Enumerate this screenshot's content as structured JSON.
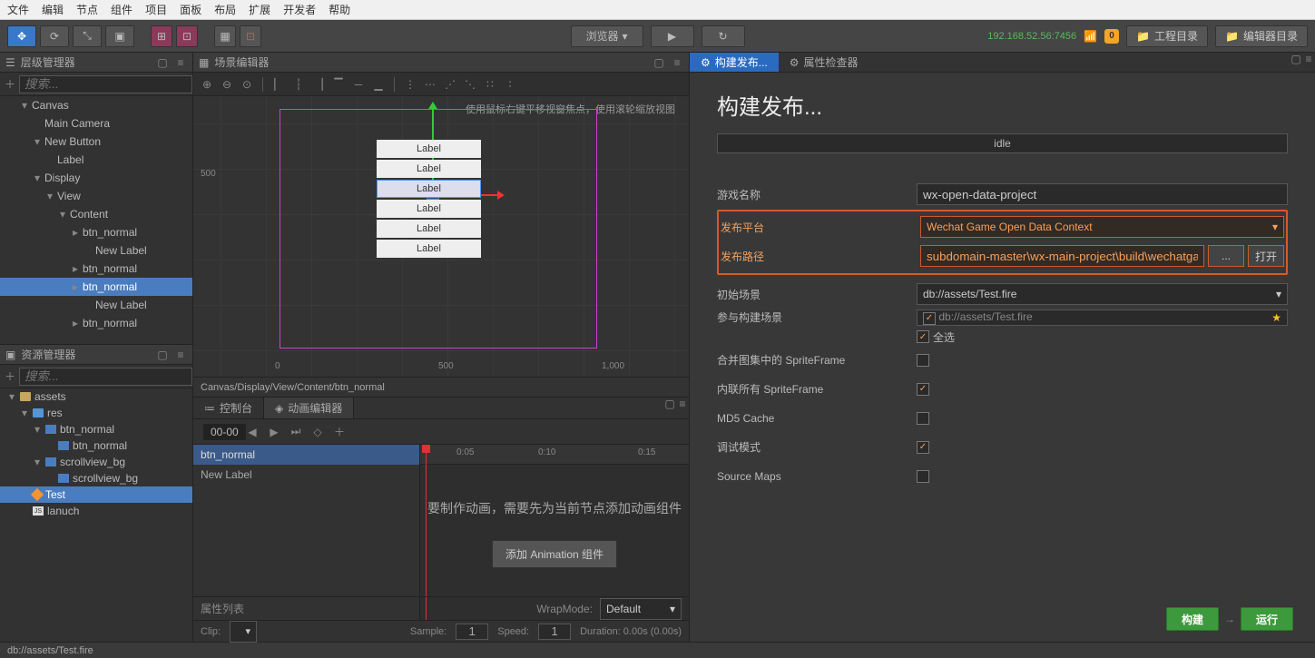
{
  "menubar": [
    "文件",
    "编辑",
    "节点",
    "组件",
    "项目",
    "面板",
    "布局",
    "扩展",
    "开发者",
    "帮助"
  ],
  "toolbar": {
    "preview_mode": "浏览器",
    "ip": "192.168.52.56:7456",
    "badge": "0",
    "project_dir": "工程目录",
    "editor_dir": "编辑器目录"
  },
  "hierarchy": {
    "title": "层级管理器",
    "search_placeholder": "搜索...",
    "tree": [
      {
        "indent": 1,
        "caret": "▾",
        "label": "Canvas"
      },
      {
        "indent": 2,
        "caret": "",
        "label": "Main Camera"
      },
      {
        "indent": 2,
        "caret": "▾",
        "label": "New Button"
      },
      {
        "indent": 3,
        "caret": "",
        "label": "Label"
      },
      {
        "indent": 2,
        "caret": "▾",
        "label": "Display"
      },
      {
        "indent": 3,
        "caret": "▾",
        "label": "View"
      },
      {
        "indent": 4,
        "caret": "▾",
        "label": "Content"
      },
      {
        "indent": 5,
        "caret": "▸",
        "label": "btn_normal"
      },
      {
        "indent": 6,
        "caret": "",
        "label": "New Label"
      },
      {
        "indent": 5,
        "caret": "▸",
        "label": "btn_normal"
      },
      {
        "indent": 5,
        "caret": "▸",
        "label": "btn_normal",
        "selected": true
      },
      {
        "indent": 6,
        "caret": "",
        "label": "New Label"
      },
      {
        "indent": 5,
        "caret": "▸",
        "label": "btn_normal"
      }
    ]
  },
  "assets": {
    "title": "资源管理器",
    "search_placeholder": "搜索...",
    "tree": [
      {
        "indent": 0,
        "caret": "▾",
        "icon": "box",
        "label": "assets"
      },
      {
        "indent": 1,
        "caret": "▾",
        "icon": "folder",
        "label": "res"
      },
      {
        "indent": 2,
        "caret": "▾",
        "icon": "img",
        "label": "btn_normal"
      },
      {
        "indent": 3,
        "caret": "",
        "icon": "img",
        "label": "btn_normal"
      },
      {
        "indent": 2,
        "caret": "▾",
        "icon": "img",
        "label": "scrollview_bg"
      },
      {
        "indent": 3,
        "caret": "",
        "icon": "img",
        "label": "scrollview_bg"
      },
      {
        "indent": 1,
        "caret": "",
        "icon": "fire",
        "label": "Test",
        "selected": true
      },
      {
        "indent": 1,
        "caret": "",
        "icon": "js",
        "label": "lanuch"
      }
    ]
  },
  "scene": {
    "title": "场景编辑器",
    "hint": "使用鼠标右键平移视窗焦点，使用滚轮缩放视图",
    "ruler_y": "500",
    "ruler_x": [
      "0",
      "500",
      "1,000"
    ],
    "labels": [
      "Label",
      "Label",
      "Label",
      "Label",
      "Label",
      "Label"
    ],
    "selected_label_index": 2,
    "breadcrumb": "Canvas/Display/View/Content/btn_normal"
  },
  "timeline": {
    "tabs": {
      "console": "控制台",
      "anim": "动画编辑器"
    },
    "timecode": "00-00",
    "ticks": [
      "0:05",
      "0:10",
      "0:15"
    ],
    "tracks": [
      {
        "label": "btn_normal",
        "selected": true
      },
      {
        "label": "New Label",
        "selected": false
      }
    ],
    "msg": "要制作动画，需要先为当前节点添加动画组件",
    "add_btn": "添加 Animation 组件",
    "props_label": "属性列表",
    "wrapmode_label": "WrapMode:",
    "wrapmode_value": "Default",
    "footer": {
      "clip": "Clip:",
      "sample": "Sample:",
      "sample_val": "1",
      "speed": "Speed:",
      "speed_val": "1",
      "duration": "Duration: 0.00s (0.00s)"
    }
  },
  "build": {
    "tab_build": "构建发布...",
    "tab_inspector": "属性检查器",
    "title": "构建发布...",
    "status": "idle",
    "fields": {
      "game_name": {
        "label": "游戏名称",
        "value": "wx-open-data-project"
      },
      "platform": {
        "label": "发布平台",
        "value": "Wechat Game Open Data Context"
      },
      "path": {
        "label": "发布路径",
        "value": "subdomain-master\\wx-main-project\\build\\wechatgame",
        "browse": "...",
        "open": "打开"
      },
      "init_scene": {
        "label": "初始场景",
        "value": "db://assets/Test.fire"
      },
      "scenes": {
        "label": "参与构建场景",
        "item": "db://assets/Test.fire",
        "all": "全选"
      },
      "merge_atlas": {
        "label": "合并图集中的 SpriteFrame",
        "checked": false
      },
      "inline_sf": {
        "label": "内联所有 SpriteFrame",
        "checked": true
      },
      "md5": {
        "label": "MD5 Cache",
        "checked": false
      },
      "debug": {
        "label": "调试模式",
        "checked": true
      },
      "sourcemaps": {
        "label": "Source Maps",
        "checked": false
      }
    },
    "build_btn": "构建",
    "run_btn": "运行"
  },
  "status_path": "db://assets/Test.fire"
}
